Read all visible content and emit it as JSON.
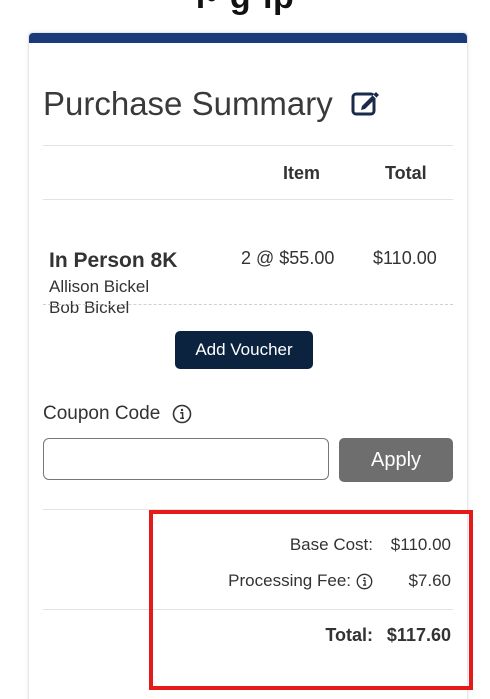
{
  "header_fragment": "ı•·g·ıp",
  "summary": {
    "title": "Purchase Summary",
    "columns": {
      "item": "Item",
      "total": "Total"
    },
    "line_item": {
      "name": "In Person 8K",
      "attendees": [
        "Allison Bickel",
        "Bob Bickel"
      ],
      "quantity_price": "2 @ $55.00",
      "total": "$110.00"
    },
    "add_voucher_label": "Add Voucher",
    "coupon": {
      "label": "Coupon Code",
      "value": "",
      "placeholder": "",
      "apply_label": "Apply"
    },
    "costs": {
      "base_label": "Base Cost:",
      "base_value": "$110.00",
      "fee_label": "Processing Fee:",
      "fee_value": "$7.60",
      "total_label": "Total:",
      "total_value": "$117.60"
    }
  },
  "colors": {
    "accent": "#1a3a7a",
    "voucher_button": "#0c2340",
    "apply_button": "#6e6e6e",
    "highlight": "#e51b1b"
  }
}
